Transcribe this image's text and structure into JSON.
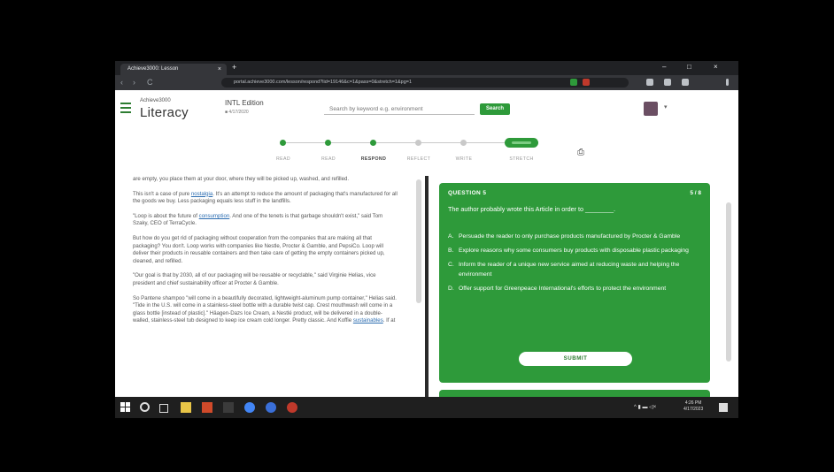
{
  "browser": {
    "tab_title": "Achieve3000: Lesson",
    "tab_close": "×",
    "new_tab": "+",
    "back": "‹",
    "forward": "›",
    "reload": "C",
    "url": "portal.achieve3000.com/lesson/respond?lid=19146&c=1&pass=0&stretch=1&pg=1",
    "win_min": "–",
    "win_max": "□",
    "win_close": "×",
    "accent_colors": {
      "ext_green": "#2e9a3a",
      "ext_red": "#c0392b"
    }
  },
  "app": {
    "brand_prefix": "Achieve3000",
    "brand": "Literacy",
    "edition": "INTL Edition",
    "edition_sub": "■ 4/17/2020",
    "search_placeholder": "Search by keyword e.g. environment",
    "search_button": "Search",
    "user_caret": "▾",
    "accent": "#2e9a3a"
  },
  "stepper": {
    "steps": [
      "READ",
      "READ",
      "RESPOND",
      "REFLECT",
      "WRITE",
      "STRETCH"
    ],
    "current": "RESPOND"
  },
  "article": {
    "paragraphs": [
      {
        "pre": "are empty, you place them at your door, where they will be picked up, washed, and refilled.",
        "link": "",
        "post": ""
      },
      {
        "pre": "This isn't a case of pure ",
        "link": "nostalgia",
        "post": ". It's an attempt to reduce the amount of packaging that's manufactured for all the goods we buy. Less packaging equals less stuff in the landfills."
      },
      {
        "pre": "\"Loop is about the future of ",
        "link": "consumption",
        "post": ". And one of the tenets is that garbage shouldn't exist,\" said Tom Szaky, CEO of TerraCycle."
      },
      {
        "pre": "But how do you get rid of packaging without cooperation from the companies that are making all that packaging? You don't. Loop works with companies like Nestle, Procter & Gamble, and PepsiCo. Loop will deliver their products in reusable containers and then take care of getting the empty containers picked up, cleaned, and refilled.",
        "link": "",
        "post": ""
      },
      {
        "pre": "\"Our goal is that by 2030, all of our packaging will be reusable or recyclable,\" said Virginie Helias, vice president and chief sustainability officer at Procter & Gamble.",
        "link": "",
        "post": ""
      },
      {
        "pre": "So Pantene shampoo \"will come in a beautifully decorated, lightweight-aluminum pump container,\" Helias said. \"Tide in the U.S. will come in a stainless-steel bottle with a durable twist cap. Crest mouthwash will come in a glass bottle [instead of plastic].\" Häagen-Dazs Ice Cream, a Nestlé product, will be delivered in a double-walled, stainless-steel tub designed to keep ice cream cold longer. Pretty classic. And Koffie ",
        "link": "sustainables",
        "post": ". If at"
      }
    ]
  },
  "question": {
    "title": "QUESTION 5",
    "count": "5 / 8",
    "prompt": "The author probably wrote this Article in order to ________.",
    "choices": [
      {
        "letter": "A.",
        "text": "Persuade the reader to only purchase products manufactured by Procter & Gamble"
      },
      {
        "letter": "B.",
        "text": "Explore reasons why some consumers buy products with disposable plastic packaging"
      },
      {
        "letter": "C.",
        "text": "Inform the reader of a unique new service aimed at reducing waste and helping the environment"
      },
      {
        "letter": "D.",
        "text": "Offer support for Greenpeace International's efforts to protect the environment"
      }
    ],
    "submit": "SUBMIT"
  },
  "taskbar": {
    "time": "4:26 PM",
    "date": "4/17/2023",
    "tray": "^ ▮ ▬ ◁×"
  }
}
